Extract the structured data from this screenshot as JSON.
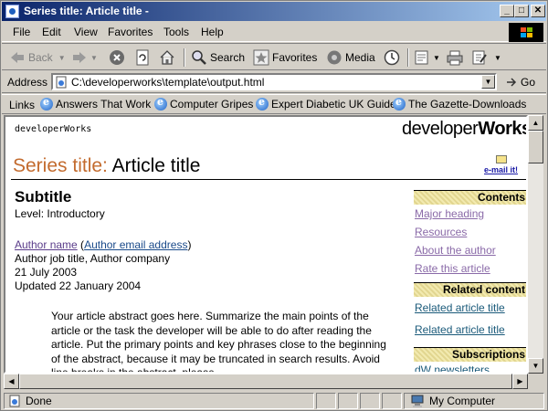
{
  "window": {
    "title": "Series title: Article title -"
  },
  "menubar": {
    "items": [
      "File",
      "Edit",
      "View",
      "Favorites",
      "Tools",
      "Help"
    ]
  },
  "toolbar": {
    "back": "Back",
    "search": "Search",
    "favorites": "Favorites",
    "media": "Media"
  },
  "address": {
    "label": "Address",
    "url": "C:\\developerworks\\template\\output.html",
    "go": "Go"
  },
  "links": {
    "label": "Links",
    "items": [
      "Answers That Work",
      "Computer Gripes",
      "Expert Diabetic UK Guide",
      "The Gazette-Downloads"
    ]
  },
  "page": {
    "site_small": "developerWorks",
    "logo_light": "developer",
    "logo_bold": "Works",
    "series_title": "Series title:",
    "article_title": "Article title",
    "email_it": "e-mail it!",
    "subtitle": "Subtitle",
    "level": "Level: Introductory",
    "author_name": "Author name",
    "author_email": "Author email address",
    "author_job": "Author job title, Author company",
    "date": "21 July 2003",
    "updated": "Updated 22 January 2004",
    "abstract": "Your article abstract goes here. Summarize the main points of the article or the task the developer will be able to do after reading the article. Put the primary points and key phrases close to the beginning of the abstract, because it may be truncated in search results. Avoid line breaks in the abstract, please."
  },
  "sidebar": {
    "contents_header": "Contents:",
    "contents": [
      "Major heading",
      "Resources",
      "About the author",
      "Rate this article"
    ],
    "related_header": "Related content:",
    "related": [
      "Related article title",
      "Related article title"
    ],
    "subscriptions_header": "Subscriptions:",
    "subscriptions": [
      "dW newsletters"
    ]
  },
  "status": {
    "text": "Done",
    "zone": "My Computer"
  }
}
